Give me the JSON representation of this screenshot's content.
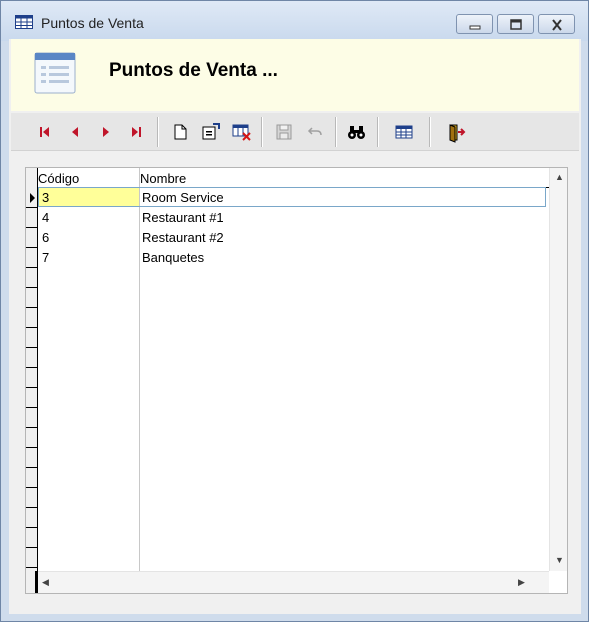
{
  "window": {
    "title": "Puntos de Venta",
    "header_title": "Puntos de Venta ..."
  },
  "toolbar": {
    "buttons": [
      {
        "name": "first-record",
        "icon": "first-record-icon",
        "enabled": true
      },
      {
        "name": "previous-record",
        "icon": "previous-record-icon",
        "enabled": true
      },
      {
        "name": "next-record",
        "icon": "next-record-icon",
        "enabled": true
      },
      {
        "name": "last-record",
        "icon": "last-record-icon",
        "enabled": true
      },
      {
        "name": "new-record",
        "icon": "new-document-icon",
        "enabled": true
      },
      {
        "name": "edit-record",
        "icon": "edit-record-icon",
        "enabled": true
      },
      {
        "name": "delete-record",
        "icon": "delete-record-icon",
        "enabled": true
      },
      {
        "name": "save-record",
        "icon": "save-icon",
        "enabled": false
      },
      {
        "name": "undo",
        "icon": "undo-icon",
        "enabled": false
      },
      {
        "name": "search",
        "icon": "binoculars-icon",
        "enabled": true
      },
      {
        "name": "grid-view",
        "icon": "table-icon",
        "enabled": true
      },
      {
        "name": "exit",
        "icon": "exit-door-icon",
        "enabled": true
      }
    ]
  },
  "grid": {
    "columns": [
      "Código",
      "Nombre"
    ],
    "rows": [
      {
        "codigo": "3",
        "nombre": "Room Service"
      },
      {
        "codigo": "4",
        "nombre": "Restaurant #1"
      },
      {
        "codigo": "6",
        "nombre": "Restaurant #2"
      },
      {
        "codigo": "7",
        "nombre": "Banquetes"
      }
    ],
    "current_row": 0
  },
  "colors": {
    "header_bg": "#fdfde6",
    "current_cell": "#ffff99",
    "nav_arrows": "#c0152a"
  }
}
